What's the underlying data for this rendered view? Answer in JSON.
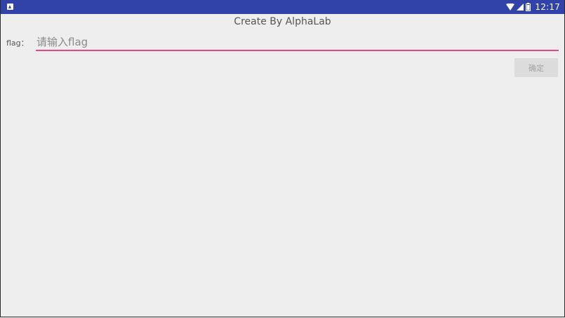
{
  "status_bar": {
    "time": "12:17",
    "color": "#3143a8",
    "icons": [
      "notification-icon",
      "wifi-icon",
      "signal-icon",
      "battery-icon"
    ]
  },
  "app": {
    "title": "Create By AlphaLab"
  },
  "form": {
    "flag_label": "flag：",
    "flag_placeholder": "请输入flag",
    "flag_value": "",
    "confirm_label": "确定",
    "accent_color": "#e8497f"
  }
}
